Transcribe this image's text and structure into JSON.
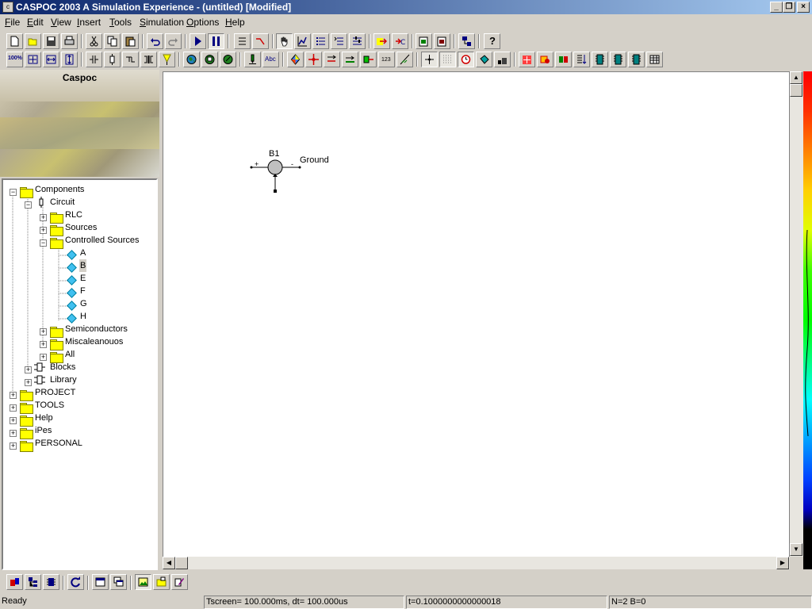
{
  "window": {
    "title": "CASPOC 2003 A Simulation Experience - (untitled) [Modified]",
    "controls": [
      "_",
      "❐",
      "×"
    ]
  },
  "menu": [
    {
      "label": "File",
      "key": "F",
      "rest": "ile"
    },
    {
      "label": "Edit",
      "key": "E",
      "rest": "dit"
    },
    {
      "label": "View",
      "key": "V",
      "rest": "iew"
    },
    {
      "label": "Insert",
      "key": "I",
      "rest": "nsert"
    },
    {
      "label": "Tools",
      "key": "T",
      "rest": "ools"
    },
    {
      "label": "Simulation",
      "key": "S",
      "rest": "imulation"
    },
    {
      "label": "Options",
      "key": "O",
      "rest": "ptions"
    },
    {
      "label": "Help",
      "key": "H",
      "rest": "elp"
    }
  ],
  "toolbar": {
    "zoom_label": "100%",
    "abc_label": "Abc",
    "num_label": "123",
    "help_label": "?"
  },
  "sidebar": {
    "title": "Caspoc"
  },
  "tree": {
    "components": "Components",
    "circuit": "Circuit",
    "rlc": "RLC",
    "sources": "Sources",
    "controlled_sources": "Controlled Sources",
    "cs_items": [
      "A",
      "B",
      "E",
      "F",
      "G",
      "H"
    ],
    "selected": "B",
    "semiconductors": "Semiconductors",
    "miscellaneous": "Miscaleanouos",
    "all": "All",
    "blocks": "Blocks",
    "library": "Library",
    "project": "PROJECT",
    "tools": "TOOLS",
    "help": "Help",
    "ipes": "iPes",
    "personal": "PERSONAL"
  },
  "canvas": {
    "component_name": "B1",
    "ground_label": "Ground",
    "plus": "+",
    "minus": "-"
  },
  "status": {
    "ready": "Ready",
    "tscreen": "Tscreen= 100.000ms, dt= 100.000us",
    "time": "t=0.1000000000000018",
    "counts": "N=2 B=0"
  },
  "colors": {
    "titlebar_start": "#0a246a",
    "titlebar_end": "#a6caf0",
    "face": "#d4d0c8"
  }
}
